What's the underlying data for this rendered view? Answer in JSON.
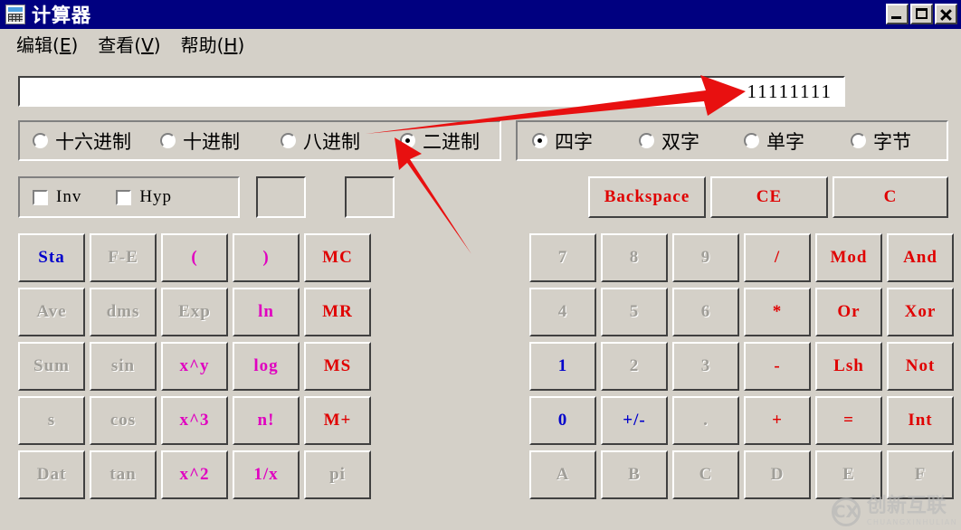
{
  "window": {
    "title": "计算器",
    "icon": "calculator-icon",
    "controls": {
      "minimize": "_",
      "maximize": "□",
      "close": "✕"
    }
  },
  "menu": [
    {
      "label": "编辑",
      "accel": "E"
    },
    {
      "label": "查看",
      "accel": "V"
    },
    {
      "label": "帮助",
      "accel": "H"
    }
  ],
  "display": {
    "value": "11111111"
  },
  "base_group": {
    "options": [
      {
        "label": "十六进制",
        "selected": false
      },
      {
        "label": "十进制",
        "selected": false
      },
      {
        "label": "八进制",
        "selected": false
      },
      {
        "label": "二进制",
        "selected": true
      }
    ]
  },
  "word_group": {
    "options": [
      {
        "label": "四字",
        "selected": true
      },
      {
        "label": "双字",
        "selected": false
      },
      {
        "label": "单字",
        "selected": false
      },
      {
        "label": "字节",
        "selected": false
      }
    ]
  },
  "modifiers": {
    "inv": {
      "label": "Inv",
      "checked": false
    },
    "hyp": {
      "label": "Hyp",
      "checked": false
    }
  },
  "indicators": [
    "",
    ""
  ],
  "top_buttons": [
    {
      "label": "Backspace",
      "color": "red"
    },
    {
      "label": "CE",
      "color": "red"
    },
    {
      "label": "C",
      "color": "red"
    }
  ],
  "left_keys": [
    [
      {
        "label": "Sta",
        "color": "blue"
      },
      {
        "label": "F-E",
        "color": "dis"
      },
      {
        "label": "(",
        "color": "magenta"
      },
      {
        "label": ")",
        "color": "magenta"
      },
      {
        "label": "MC",
        "color": "red"
      }
    ],
    [
      {
        "label": "Ave",
        "color": "dis"
      },
      {
        "label": "dms",
        "color": "dis"
      },
      {
        "label": "Exp",
        "color": "dis"
      },
      {
        "label": "ln",
        "color": "magenta"
      },
      {
        "label": "MR",
        "color": "red"
      }
    ],
    [
      {
        "label": "Sum",
        "color": "dis"
      },
      {
        "label": "sin",
        "color": "dis"
      },
      {
        "label": "x^y",
        "color": "magenta"
      },
      {
        "label": "log",
        "color": "magenta"
      },
      {
        "label": "MS",
        "color": "red"
      }
    ],
    [
      {
        "label": "s",
        "color": "dis"
      },
      {
        "label": "cos",
        "color": "dis"
      },
      {
        "label": "x^3",
        "color": "magenta"
      },
      {
        "label": "n!",
        "color": "magenta"
      },
      {
        "label": "M+",
        "color": "red"
      }
    ],
    [
      {
        "label": "Dat",
        "color": "dis"
      },
      {
        "label": "tan",
        "color": "dis"
      },
      {
        "label": "x^2",
        "color": "magenta"
      },
      {
        "label": "1/x",
        "color": "magenta"
      },
      {
        "label": "pi",
        "color": "dis"
      }
    ]
  ],
  "right_keys": [
    [
      {
        "label": "7",
        "color": "dis"
      },
      {
        "label": "8",
        "color": "dis"
      },
      {
        "label": "9",
        "color": "dis"
      },
      {
        "label": "/",
        "color": "red"
      },
      {
        "label": "Mod",
        "color": "red"
      },
      {
        "label": "And",
        "color": "red"
      }
    ],
    [
      {
        "label": "4",
        "color": "dis"
      },
      {
        "label": "5",
        "color": "dis"
      },
      {
        "label": "6",
        "color": "dis"
      },
      {
        "label": "*",
        "color": "red"
      },
      {
        "label": "Or",
        "color": "red"
      },
      {
        "label": "Xor",
        "color": "red"
      }
    ],
    [
      {
        "label": "1",
        "color": "blue"
      },
      {
        "label": "2",
        "color": "dis"
      },
      {
        "label": "3",
        "color": "dis"
      },
      {
        "label": "-",
        "color": "red"
      },
      {
        "label": "Lsh",
        "color": "red"
      },
      {
        "label": "Not",
        "color": "red"
      }
    ],
    [
      {
        "label": "0",
        "color": "blue"
      },
      {
        "label": "+/-",
        "color": "blue"
      },
      {
        "label": ".",
        "color": "dis"
      },
      {
        "label": "+",
        "color": "red"
      },
      {
        "label": "=",
        "color": "red"
      },
      {
        "label": "Int",
        "color": "red"
      }
    ],
    [
      {
        "label": "A",
        "color": "dis"
      },
      {
        "label": "B",
        "color": "dis"
      },
      {
        "label": "C",
        "color": "dis"
      },
      {
        "label": "D",
        "color": "dis"
      },
      {
        "label": "E",
        "color": "dis"
      },
      {
        "label": "F",
        "color": "dis"
      }
    ]
  ],
  "annotations": {
    "color": "#e81010",
    "arrow_to_display": "points right at the displayed binary value",
    "arrow_to_binary_radio": "points up-left at the 二进制 radio button"
  },
  "watermark": {
    "logo": "CX",
    "main": "创新互联",
    "sub": "CHUANGXINHULIAN"
  }
}
